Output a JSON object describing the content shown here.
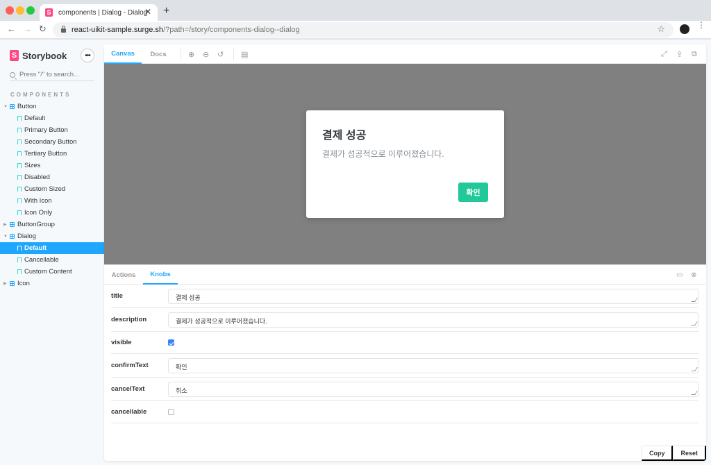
{
  "browser": {
    "tab_title": "components | Dialog - Dialog",
    "tab_favicon": "S",
    "url_host": "react-uikit-sample.surge.sh",
    "url_path": "/?path=/story/components-dialog--dialog",
    "icons": {
      "back": "←",
      "forward": "→",
      "reload": "↻",
      "star": "☆",
      "close": "✕",
      "new_tab": "+",
      "kebab": "⋮"
    }
  },
  "sidebar": {
    "brand": "Storybook",
    "brand_logo": "S",
    "more_label": "•••",
    "search_placeholder": "Press \"/\" to search...",
    "section_title": "COMPONENTS",
    "tree": [
      {
        "type": "component",
        "label": "Button",
        "expanded": true,
        "children": [
          {
            "label": "Default"
          },
          {
            "label": "Primary Button"
          },
          {
            "label": "Secondary Button"
          },
          {
            "label": "Tertiary Button"
          },
          {
            "label": "Sizes"
          },
          {
            "label": "Disabled"
          },
          {
            "label": "Custom Sized"
          },
          {
            "label": "With Icon"
          },
          {
            "label": "Icon Only"
          }
        ]
      },
      {
        "type": "component",
        "label": "ButtonGroup",
        "expanded": false
      },
      {
        "type": "component",
        "label": "Dialog",
        "expanded": true,
        "children": [
          {
            "label": "Default",
            "active": true
          },
          {
            "label": "Cancellable"
          },
          {
            "label": "Custom Content"
          }
        ]
      },
      {
        "type": "component",
        "label": "Icon",
        "expanded": false
      }
    ]
  },
  "toolbar": {
    "tabs": [
      {
        "label": "Canvas",
        "active": true
      },
      {
        "label": "Docs",
        "active": false
      }
    ],
    "icons": {
      "zoom_in": "⊕",
      "zoom_out": "⊖",
      "zoom_reset": "↺",
      "background": "▤",
      "fullscreen": "⤢",
      "share": "⇪",
      "copy": "⧉"
    }
  },
  "preview": {
    "dialog": {
      "title": "결제 성공",
      "description": "결제가 성공적으로 이루어졌습니다.",
      "confirm_label": "확인"
    },
    "accent": "#20c997"
  },
  "addons": {
    "tabs": [
      {
        "label": "Actions",
        "active": false
      },
      {
        "label": "Knobs",
        "active": true
      }
    ],
    "icons": {
      "panel_position": "▭",
      "close": "⊗"
    },
    "knobs": {
      "title": {
        "label": "title",
        "value": "결제 성공"
      },
      "description": {
        "label": "description",
        "value": "결제가 성공적으로 이루어졌습니다."
      },
      "visible": {
        "label": "visible",
        "checked": true
      },
      "confirmText": {
        "label": "confirmText",
        "value": "확인"
      },
      "cancelText": {
        "label": "cancelText",
        "value": "취소"
      },
      "cancellable": {
        "label": "cancellable",
        "checked": false
      }
    },
    "copy_label": "Copy",
    "reset_label": "Reset"
  }
}
